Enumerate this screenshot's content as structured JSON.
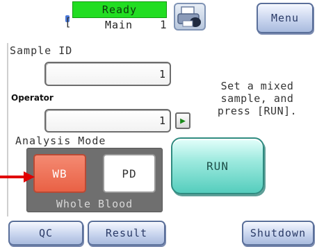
{
  "status": {
    "state": "Ready",
    "screen": "Main",
    "bracket_right": "1"
  },
  "menu_label": "Menu",
  "sample_id": {
    "label": "Sample ID",
    "value": "1"
  },
  "operator": {
    "label": "Operator",
    "value": "1"
  },
  "instruction_lines": [
    "Set a mixed",
    "sample, and",
    "press [RUN]."
  ],
  "analysis_mode": {
    "label": "Analysis Mode",
    "options": [
      "WB",
      "PD"
    ],
    "selected": "WB",
    "caption": "Whole Blood"
  },
  "run_label": "RUN",
  "footer": {
    "qc_label": "QC",
    "result_label": "Result",
    "shutdown_label": "Shutdown"
  },
  "colors": {
    "ready_bg": "#22dd22",
    "selected_mode": "#e96145",
    "run_button": "#55cdbd",
    "arrow": "#e00000"
  },
  "icons": {
    "printer": "printer-icon",
    "next": "play-arrow-icon",
    "pointer": "red-arrow-icon"
  }
}
